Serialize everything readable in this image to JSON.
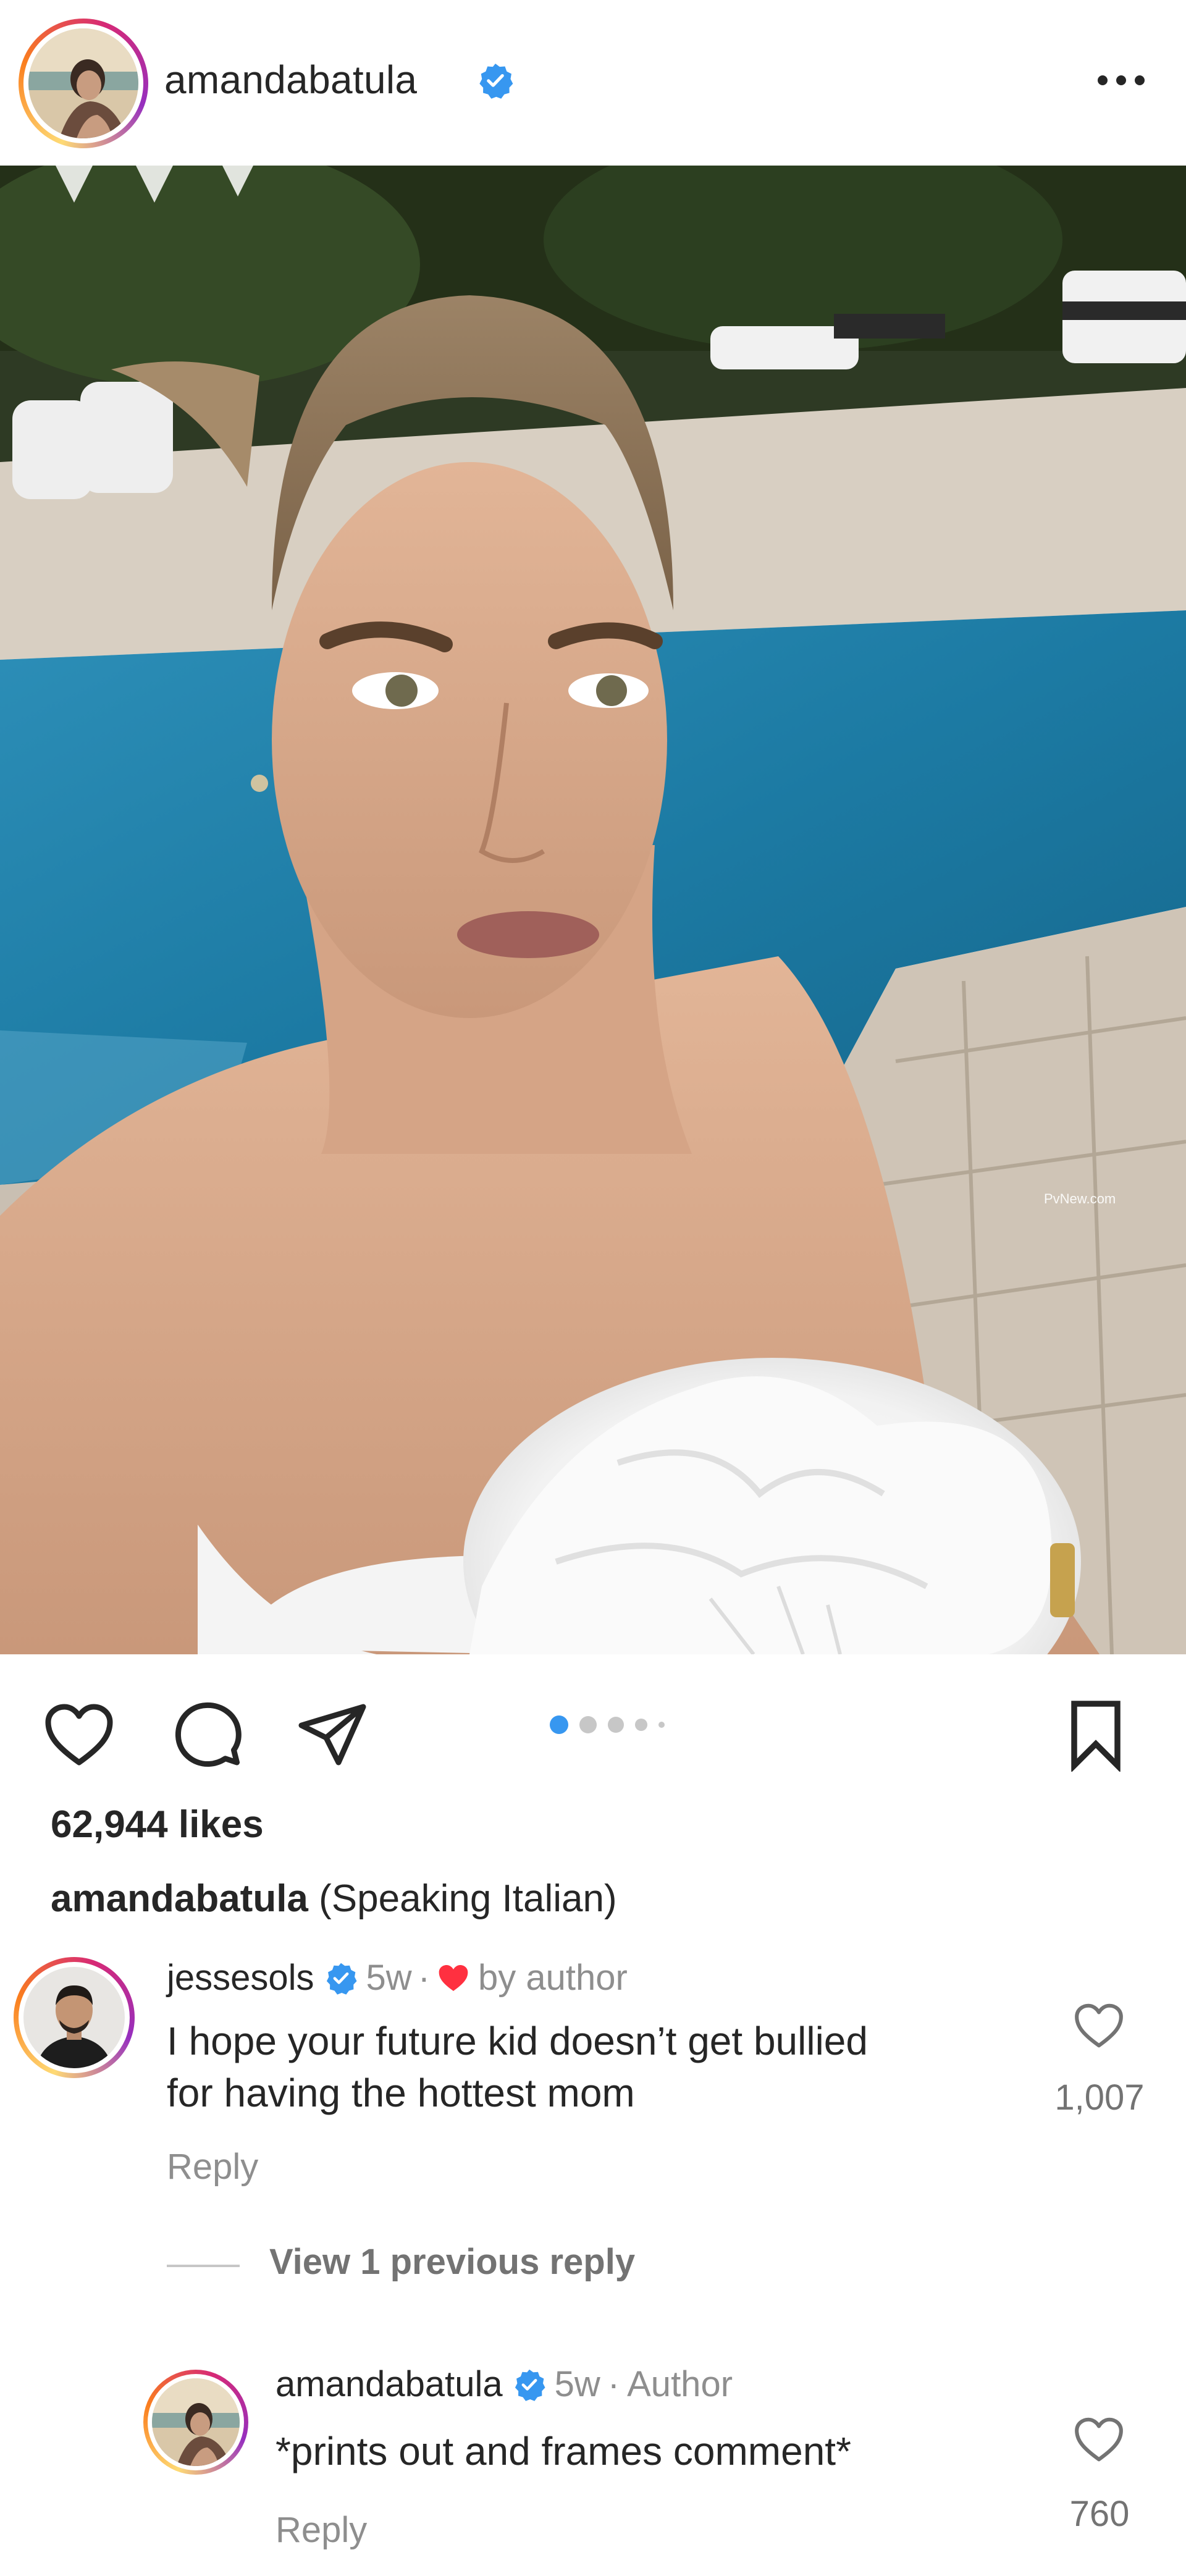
{
  "post": {
    "author": "amandabatula",
    "verified": true,
    "likes": "62,944 likes",
    "caption_user": "amandabatula",
    "caption_text": "(Speaking Italian)",
    "carousel": {
      "count": 5,
      "active_index": 0
    },
    "watermark": "PvNew.com"
  },
  "icons": {
    "like": "heart-icon",
    "comment": "comment-bubble-icon",
    "share": "paper-plane-icon",
    "save": "bookmark-icon",
    "more": "more-options-icon",
    "verified": "verified-badge-icon"
  },
  "colors": {
    "verified_blue": "#3797f0",
    "heart_red": "#ff3040",
    "text": "#262626",
    "muted": "#8e8e8e"
  },
  "comments": [
    {
      "username": "jessesols",
      "verified": true,
      "time": "5w",
      "separator": "·",
      "meta": "by author",
      "text_line1": "I hope your future kid doesn’t get bullied",
      "text_line2": "for having the hottest mom",
      "reply_label": "Reply",
      "like_count": "1,007"
    },
    {
      "username": "amandabatula",
      "verified": true,
      "time": "5w",
      "separator": "·",
      "meta": "Author",
      "text": "*prints out and frames comment*",
      "reply_label": "Reply",
      "like_count": "760"
    }
  ],
  "view_previous": "View 1 previous reply"
}
